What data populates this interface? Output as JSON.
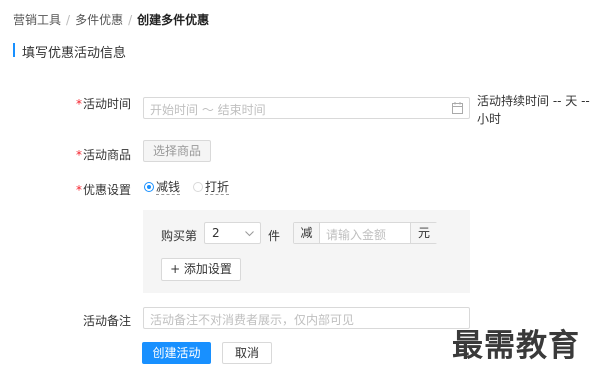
{
  "breadcrumb": {
    "items": [
      "营销工具",
      "多件优惠"
    ],
    "separator": "/",
    "current": "创建多件优惠"
  },
  "section": {
    "title": "填写优惠活动信息"
  },
  "form": {
    "required_mark": "*",
    "time": {
      "label": "活动时间",
      "placeholder": "开始时间 ～ 结束时间",
      "duration_line1": "活动持续时间 -- 天 --",
      "duration_line2": "小时",
      "icon": "calendar-icon"
    },
    "product": {
      "label": "活动商品",
      "button": "选择商品"
    },
    "discount": {
      "label": "优惠设置",
      "options": [
        "减钱",
        "打折"
      ],
      "selected": "减钱",
      "rule": {
        "buy_prefix": "购买第",
        "quantity": "2",
        "unit": "件",
        "minus": "减",
        "amount_placeholder": "请输入金额",
        "currency": "元"
      },
      "add_button": "+ 添加设置"
    },
    "remark": {
      "label": "活动备注",
      "placeholder": "活动备注不对消费者展示，仅内部可见"
    }
  },
  "actions": {
    "submit": "创建活动",
    "cancel": "取消"
  },
  "watermark": "最需教育",
  "colors": {
    "primary": "#1890ff",
    "required": "#f5222d",
    "panel": "#f5f5f5"
  }
}
